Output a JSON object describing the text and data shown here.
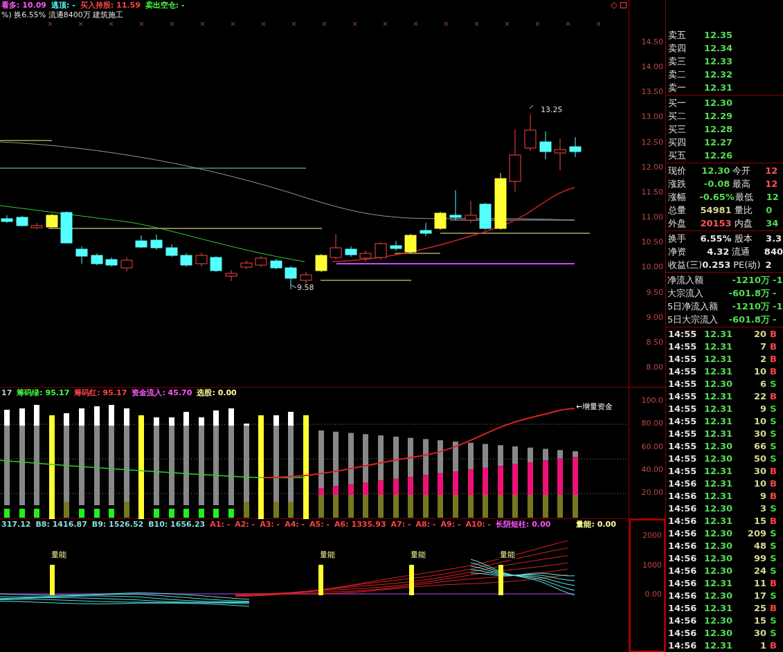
{
  "price_panel": {
    "legend": [
      {
        "text": "看多: 10.09",
        "color": "#ff55ff"
      },
      {
        "text": "逃顶: -",
        "color": "#55ffff"
      },
      {
        "text": "买入持股: 11.59",
        "color": "#ff4444"
      },
      {
        "text": "卖出空仓: -",
        "color": "#44ff44"
      }
    ],
    "info_line": "%) 换6.55% 流通8400万 建筑施工",
    "high_label": "13.25",
    "low_label": "9.58",
    "axis": [
      "14.50",
      "14.00",
      "13.50",
      "13.00",
      "12.50",
      "12.00",
      "11.50",
      "11.00",
      "10.50",
      "10.00",
      "9.50",
      "9.00",
      "8.50",
      "8.00"
    ]
  },
  "indicator_panel": {
    "legend": [
      {
        "text": "17",
        "color": "#c0c0c0"
      },
      {
        "text": "筹码绿: 95.17",
        "color": "#44ff44"
      },
      {
        "text": "筹码红: 95.17",
        "color": "#ff4444"
      },
      {
        "text": "资金流入: 45.70",
        "color": "#ff55ff"
      },
      {
        "text": "选股: 0.00",
        "color": "#ffff99"
      }
    ],
    "line_label": "←增量资金",
    "axis": [
      "100.0",
      "80.00",
      "60.00",
      "40.00",
      "20.00"
    ]
  },
  "volume_panel": {
    "legend": [
      {
        "text": "317.12",
        "color": "#88dddd"
      },
      {
        "text": "B8: 1416.87",
        "color": "#88dddd"
      },
      {
        "text": "B9: 1526.52",
        "color": "#88dddd"
      },
      {
        "text": "B10: 1656.23",
        "color": "#88dddd"
      },
      {
        "text": "A1: -",
        "color": "#ff4444"
      },
      {
        "text": "A2: -",
        "color": "#ff4444"
      },
      {
        "text": "A3: -",
        "color": "#ff4444"
      },
      {
        "text": "A4: -",
        "color": "#ff4444"
      },
      {
        "text": "A5: -",
        "color": "#ff4444"
      },
      {
        "text": "A6: 1335.93",
        "color": "#ff4444"
      },
      {
        "text": "A7: -",
        "color": "#ff4444"
      },
      {
        "text": "A8: -",
        "color": "#ff4444"
      },
      {
        "text": "A9: -",
        "color": "#ff4444"
      },
      {
        "text": "A10: -",
        "color": "#ff4444"
      },
      {
        "text": "长阴短柱: 0.00",
        "color": "#ff55ff"
      }
    ],
    "energy_legend": "量能: 0.00",
    "bar_labels": [
      "量能",
      "量能",
      "量能",
      "量能"
    ],
    "axis": [
      "2000",
      "1000",
      "0.00"
    ]
  },
  "order_book": {
    "sell": [
      {
        "label": "卖五",
        "price": "12.35"
      },
      {
        "label": "卖四",
        "price": "12.34"
      },
      {
        "label": "卖三",
        "price": "12.33"
      },
      {
        "label": "卖二",
        "price": "12.32"
      },
      {
        "label": "卖一",
        "price": "12.31"
      }
    ],
    "buy": [
      {
        "label": "买一",
        "price": "12.30"
      },
      {
        "label": "买二",
        "price": "12.29"
      },
      {
        "label": "买三",
        "price": "12.28"
      },
      {
        "label": "买四",
        "price": "12.27"
      },
      {
        "label": "买五",
        "price": "12.26"
      }
    ]
  },
  "quote": [
    {
      "label": "现价",
      "value": "12.30",
      "color": "#55dd55",
      "right": {
        "label": "今开",
        "value": "12",
        "color": "#ff5555"
      }
    },
    {
      "label": "涨跌",
      "value": "-0.08",
      "color": "#55dd55",
      "right": {
        "label": "最高",
        "value": "12",
        "color": "#ff5555"
      }
    },
    {
      "label": "涨幅",
      "value": "-0.65%",
      "color": "#55dd55",
      "right": {
        "label": "最低",
        "value": "12",
        "color": "#55dd55"
      }
    },
    {
      "label": "总量",
      "value": "54981",
      "color": "#d8d890",
      "right": {
        "label": "量比",
        "value": "0",
        "color": "#55dd55"
      }
    },
    {
      "label": "外盘",
      "value": "20153",
      "color": "#ff5555",
      "right": {
        "label": "内盘",
        "value": "34",
        "color": "#55dd55"
      }
    }
  ],
  "stats": [
    {
      "label": "换手",
      "value": "6.55%",
      "label2": "股本",
      "value2": "3.3"
    },
    {
      "label": "净资",
      "value": "4.32",
      "label2": "流通",
      "value2": "840"
    },
    {
      "label": "收益(三)",
      "value": "0.253",
      "label2": "PE(动)",
      "value2": "2"
    }
  ],
  "flows": [
    {
      "label": "净流入额",
      "value": "-1210万",
      "value2": "-1"
    },
    {
      "label": "大宗流入",
      "value": "-601.8万",
      "value2": "-"
    },
    {
      "label": "5日净流入额",
      "value": "-1210万",
      "value2": "-1"
    },
    {
      "label": "5日大宗流入",
      "value": "-601.8万",
      "value2": "-"
    }
  ],
  "trades": [
    {
      "time": "14:55",
      "price": "12.31",
      "volume": "20",
      "side": "B",
      "kind": "buy"
    },
    {
      "time": "14:55",
      "price": "12.31",
      "volume": "7",
      "side": "B",
      "kind": "buy"
    },
    {
      "time": "14:55",
      "price": "12.31",
      "volume": "2",
      "side": "B",
      "kind": "buy"
    },
    {
      "time": "14:55",
      "price": "12.31",
      "volume": "10",
      "side": "B",
      "kind": "buy"
    },
    {
      "time": "14:55",
      "price": "12.30",
      "volume": "6",
      "side": "S",
      "kind": "sell"
    },
    {
      "time": "14:55",
      "price": "12.31",
      "volume": "22",
      "side": "B",
      "kind": "buy"
    },
    {
      "time": "14:55",
      "price": "12.31",
      "volume": "9",
      "side": "S",
      "kind": "sell"
    },
    {
      "time": "14:55",
      "price": "12.31",
      "volume": "10",
      "side": "S",
      "kind": "sell"
    },
    {
      "time": "14:55",
      "price": "12.31",
      "volume": "30",
      "side": "S",
      "kind": "sell"
    },
    {
      "time": "14:55",
      "price": "12.30",
      "volume": "66",
      "side": "S",
      "kind": "sell"
    },
    {
      "time": "14:55",
      "price": "12.30",
      "volume": "50",
      "side": "S",
      "kind": "sell"
    },
    {
      "time": "14:55",
      "price": "12.31",
      "volume": "30",
      "side": "B",
      "kind": "buy"
    },
    {
      "time": "14:56",
      "price": "12.31",
      "volume": "10",
      "side": "B",
      "kind": "buy"
    },
    {
      "time": "14:56",
      "price": "12.31",
      "volume": "9",
      "side": "B",
      "kind": "buy"
    },
    {
      "time": "14:56",
      "price": "12.30",
      "volume": "3",
      "side": "S",
      "kind": "sell"
    },
    {
      "time": "14:56",
      "price": "12.31",
      "volume": "15",
      "side": "B",
      "kind": "buy"
    },
    {
      "time": "14:56",
      "price": "12.30",
      "volume": "209",
      "side": "S",
      "kind": "sell"
    },
    {
      "time": "14:56",
      "price": "12.30",
      "volume": "48",
      "side": "S",
      "kind": "sell"
    },
    {
      "time": "14:56",
      "price": "12.30",
      "volume": "99",
      "side": "S",
      "kind": "sell"
    },
    {
      "time": "14:56",
      "price": "12.30",
      "volume": "24",
      "side": "S",
      "kind": "sell"
    },
    {
      "time": "14:56",
      "price": "12.31",
      "volume": "11",
      "side": "B",
      "kind": "buy"
    },
    {
      "time": "14:56",
      "price": "12.30",
      "volume": "17",
      "side": "S",
      "kind": "sell"
    },
    {
      "time": "14:56",
      "price": "12.31",
      "volume": "25",
      "side": "B",
      "kind": "buy"
    },
    {
      "time": "14:56",
      "price": "12.30",
      "volume": "15",
      "side": "S",
      "kind": "sell"
    },
    {
      "time": "14:56",
      "price": "12.30",
      "volume": "30",
      "side": "S",
      "kind": "sell"
    },
    {
      "time": "14:56",
      "price": "12.31",
      "volume": "1",
      "side": "B",
      "kind": "buy"
    }
  ]
}
